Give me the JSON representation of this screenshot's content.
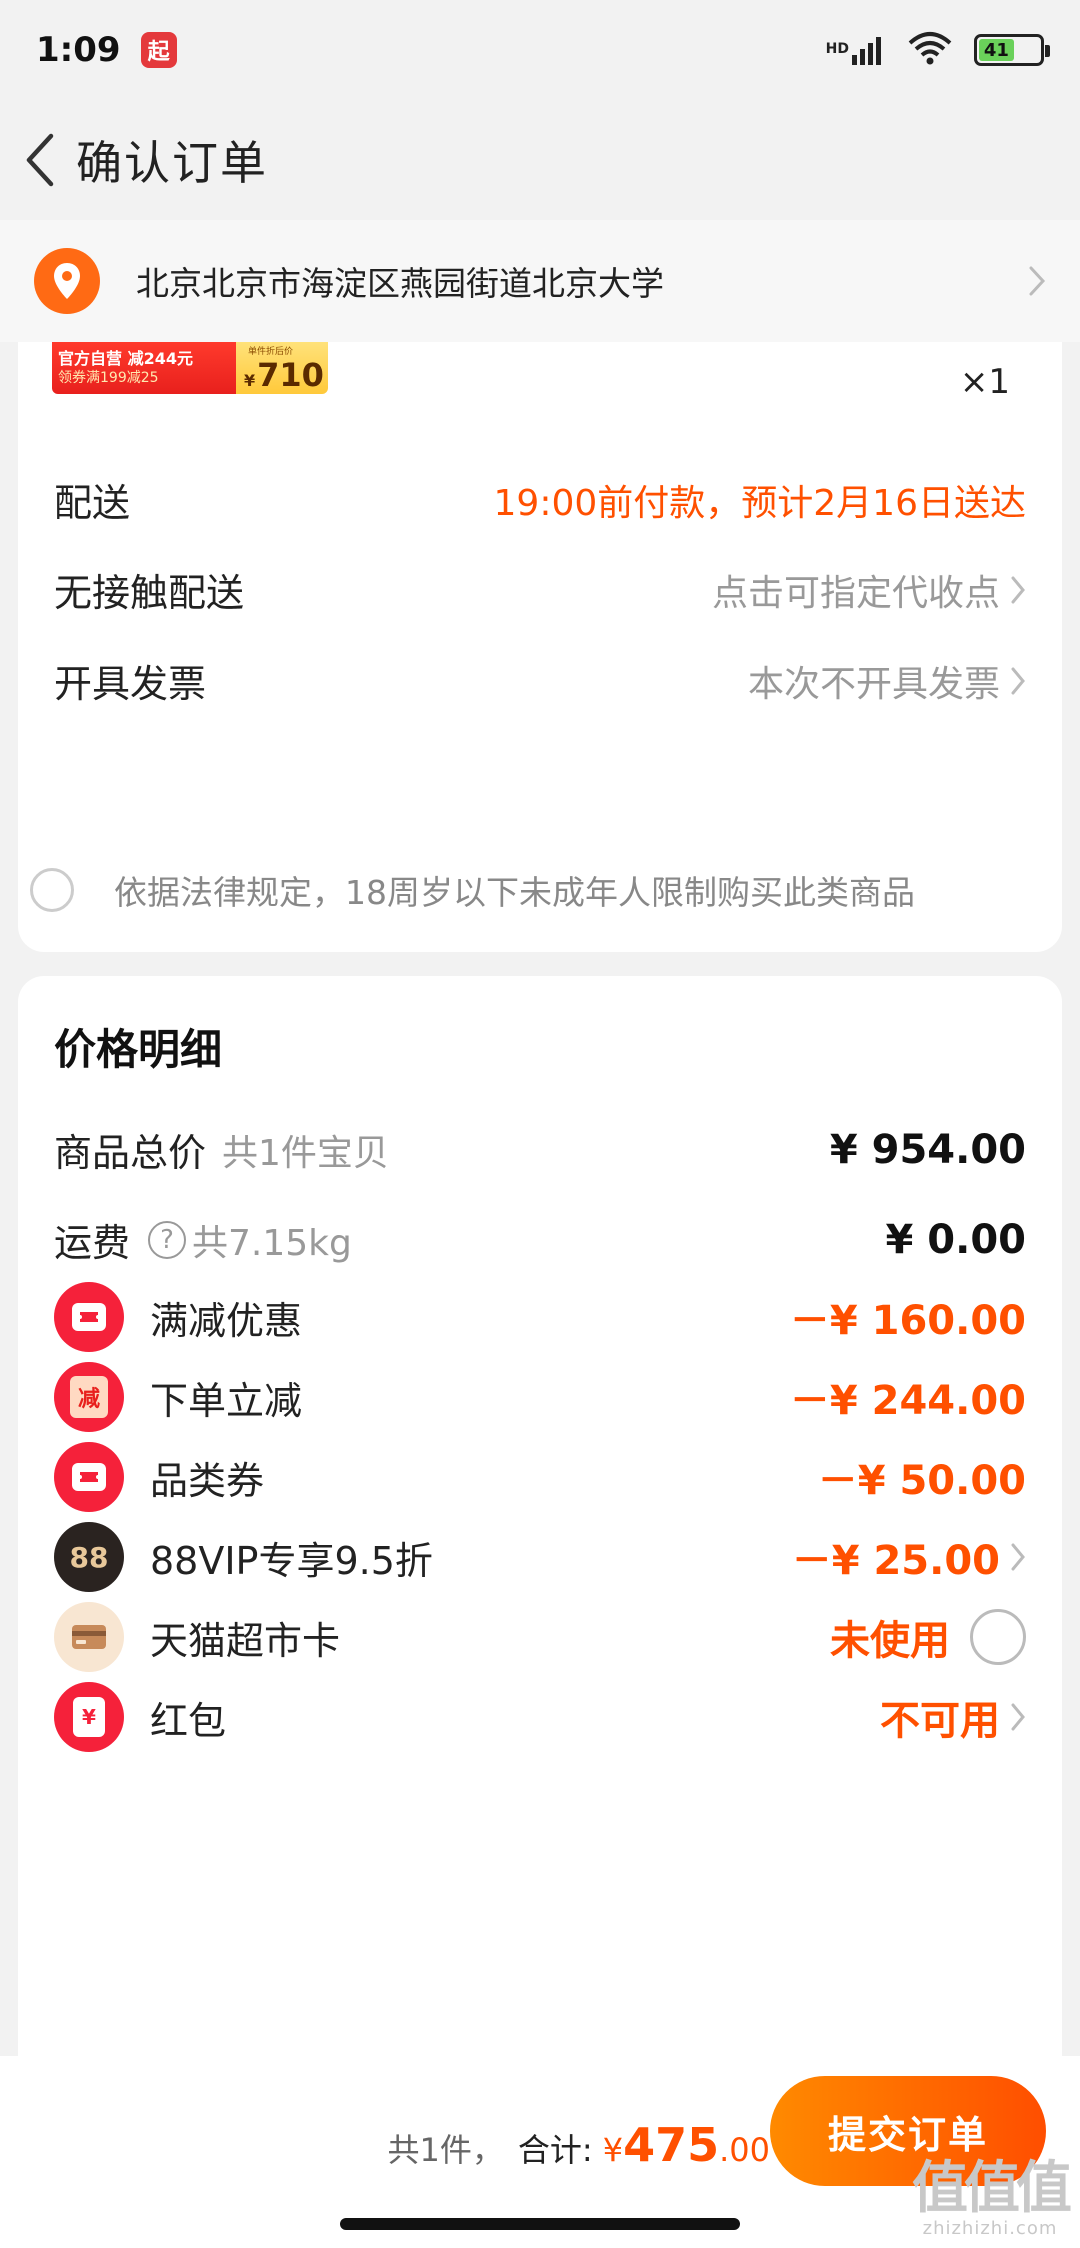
{
  "status_bar": {
    "time": "1:09",
    "app_badge": "起",
    "network": "HD",
    "battery": "41"
  },
  "nav": {
    "title": "确认订单"
  },
  "address": {
    "text": "北京北京市海淀区燕园街道北京大学"
  },
  "item": {
    "promo_line1": "官方自营 减244元",
    "promo_line2": "领券满199减25",
    "promo_price_caption": "单件折后价",
    "promo_price_yen": "¥",
    "promo_price": "710",
    "quantity": "×1"
  },
  "order_options": [
    {
      "label": "配送",
      "value": "19:00前付款，预计2月16日送达"
    },
    {
      "label": "无接触配送",
      "value": "点击可指定代收点"
    },
    {
      "label": "开具发票",
      "value": "本次不开具发票"
    }
  ],
  "agreement": {
    "text": "依据法律规定，18周岁以下未成年人限制购买此类商品"
  },
  "price_detail": {
    "title": "价格明细",
    "goods_total": {
      "label": "商品总价",
      "sub": "共1件宝贝",
      "value": "¥ 954.00"
    },
    "shipping": {
      "label": "运费",
      "help": "?",
      "sub": "共7.15kg",
      "value": "¥ 0.00"
    },
    "discounts": [
      {
        "label": "满减优惠",
        "value": "－¥ 160.00"
      },
      {
        "label": "下单立减",
        "icon_text": "减",
        "value": "－¥ 244.00"
      },
      {
        "label": "品类券",
        "value": "－¥ 50.00"
      },
      {
        "label": "88VIP专享9.5折",
        "icon_text": "88",
        "value": "－¥ 25.00"
      },
      {
        "label": "天猫超市卡",
        "value": "未使用"
      },
      {
        "label": "红包",
        "icon_text": "¥",
        "value": "不可用"
      }
    ]
  },
  "footer": {
    "count": "共1件，",
    "total_label": "合计:",
    "total_yen": "¥",
    "total_int": "475",
    "total_dec": ".00",
    "submit": "提交订单"
  },
  "watermark": {
    "big": "值值值",
    "small": "zhizhizhi.com"
  },
  "colors": {
    "accent": "#ff5000",
    "red": "#f5213a",
    "background": "#f2f2f2"
  }
}
